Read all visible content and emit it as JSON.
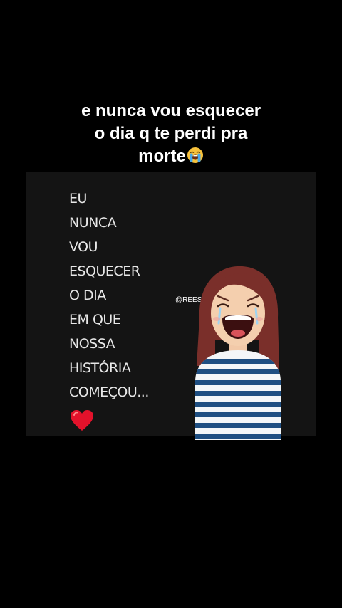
{
  "caption": {
    "line1": "e nunca vou esquecer",
    "line2": "o dia q te perdi pra",
    "line3": "morte",
    "emoji": "loudly-crying-face-emoji"
  },
  "poem": {
    "lines": [
      "EU",
      "NUNCA",
      "VOU",
      "ESQUECER",
      "O DIA",
      "EM QUE",
      "NOSSA",
      "HISTÓRIA",
      "COMEÇOU..."
    ],
    "heart_icon": "red-heart-icon"
  },
  "watermark": "@REES",
  "illustration": "crying-girl-illustration",
  "colors": {
    "background": "#000000",
    "card": "#141414",
    "heart": "#e3122b",
    "hair": "#7a2f2a",
    "stripes": "#1f4f82"
  }
}
